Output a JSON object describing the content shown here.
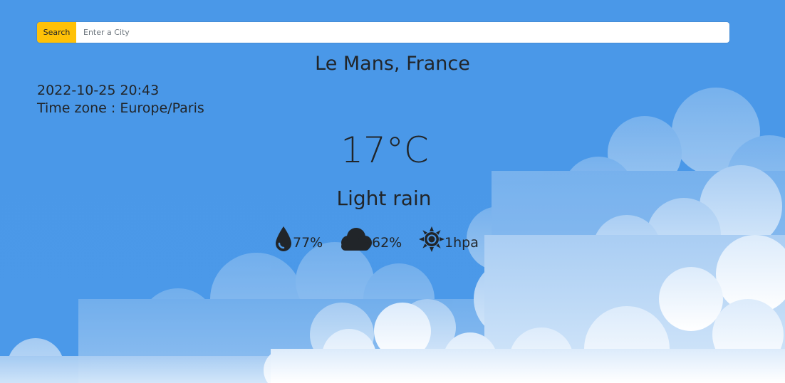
{
  "search": {
    "button_label": "Search",
    "placeholder": "Enter a City",
    "value": ""
  },
  "location": {
    "city": "Le Mans, France"
  },
  "time": {
    "datetime": "2022-10-25 20:43",
    "timezone": "Time zone : Europe/Paris"
  },
  "weather": {
    "temperature": "17°C",
    "condition": "Light rain",
    "humidity": "77%",
    "cloudiness": "62%",
    "pressure": "1hpa"
  },
  "icons": {
    "humidity": "water-drop-icon",
    "cloudiness": "cloud-icon",
    "pressure": "sun-icon"
  },
  "colors": {
    "sky": "#4a98e8",
    "search_button": "#ffc107",
    "text": "#212529"
  }
}
